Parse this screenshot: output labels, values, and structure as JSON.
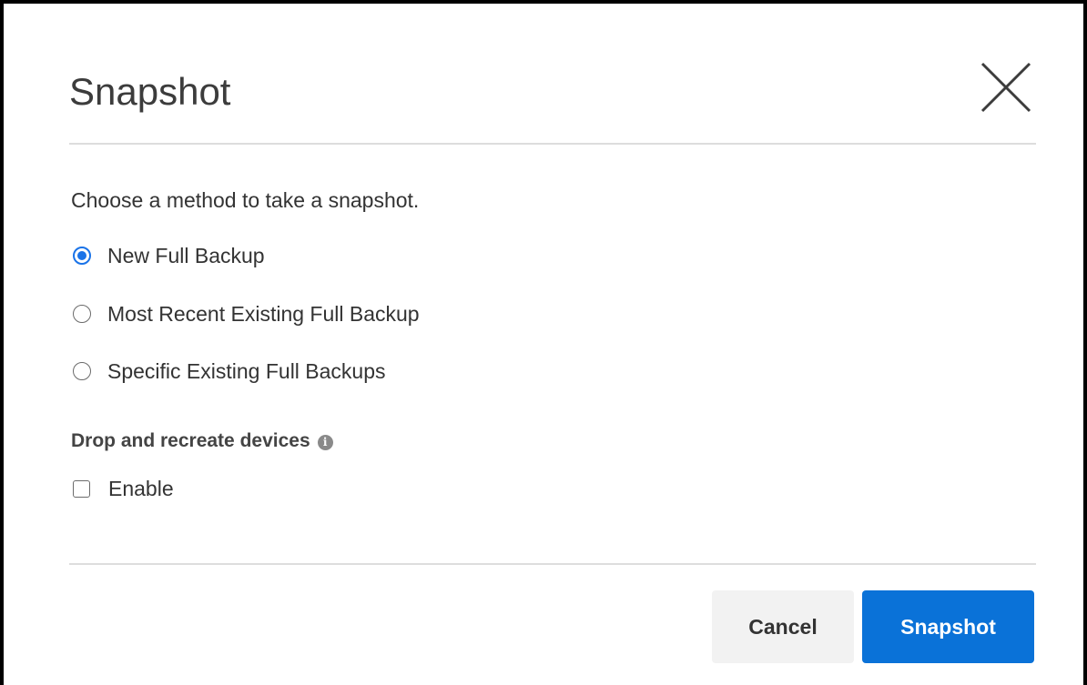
{
  "dialog": {
    "title": "Snapshot",
    "close_icon": "close-icon",
    "instructions": "Choose a method to take a snapshot.",
    "options": [
      {
        "label": "New Full Backup",
        "selected": true
      },
      {
        "label": "Most Recent Existing Full Backup",
        "selected": false
      },
      {
        "label": "Specific Existing Full Backups",
        "selected": false
      }
    ],
    "devices_section": {
      "label": "Drop and recreate devices",
      "info_icon": "info-icon",
      "checkbox_label": "Enable",
      "checked": false
    },
    "buttons": {
      "cancel": "Cancel",
      "submit": "Snapshot"
    }
  },
  "colors": {
    "accent": "#0a72d8",
    "radio_selected": "#1a73e8",
    "divider": "#dddddd",
    "cancel_bg": "#f2f2f2"
  }
}
